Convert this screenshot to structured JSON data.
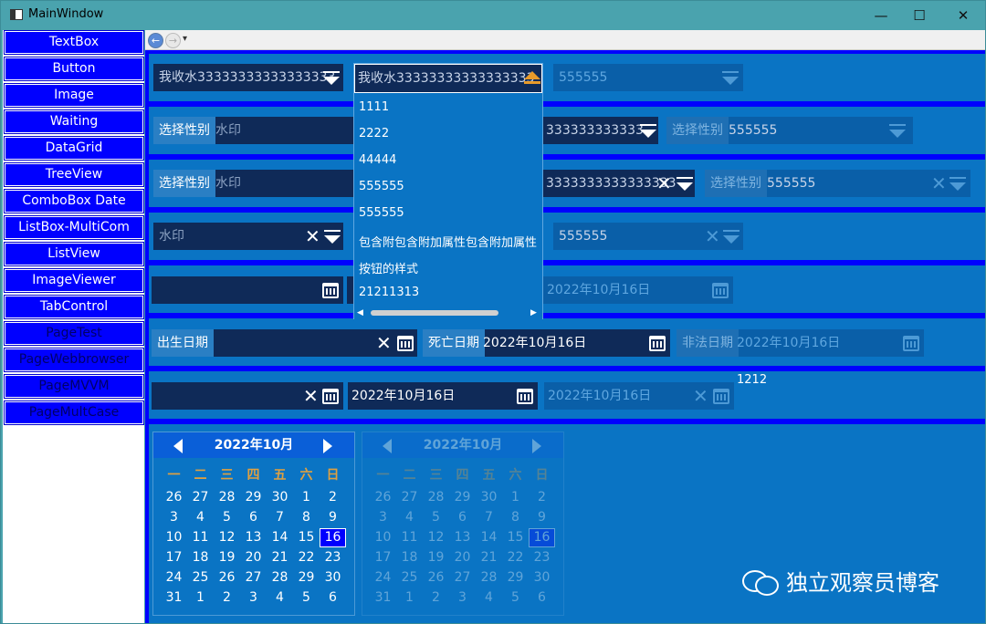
{
  "window": {
    "title": "MainWindow",
    "min": "—",
    "max": "☐",
    "close": "✕"
  },
  "sidebar": {
    "items": [
      {
        "label": "TextBox"
      },
      {
        "label": "Button"
      },
      {
        "label": "Image"
      },
      {
        "label": "Waiting"
      },
      {
        "label": "DataGrid"
      },
      {
        "label": "TreeView"
      },
      {
        "label": "ComboBox Date"
      },
      {
        "label": "ListBox-MultiCom"
      },
      {
        "label": "ListView"
      },
      {
        "label": "ImageViewer"
      },
      {
        "label": "TabControl"
      },
      {
        "label": "PageTest"
      },
      {
        "label": "PageWebbrowser"
      },
      {
        "label": "PageMVVM"
      },
      {
        "label": "PageMultCase"
      }
    ]
  },
  "browser": {
    "back": "←",
    "fwd": "→",
    "menu": "▾"
  },
  "row1": {
    "c1": "我收水33333333333333333",
    "c2": "我收水33333333333333333",
    "c3": "555555"
  },
  "row2": {
    "label": "选择性别",
    "c1": "水印",
    "c2": "333333333333",
    "label2": "选择性别",
    "c3": "555555"
  },
  "row3": {
    "label": "选择性别",
    "c1": "水印",
    "c2": "3333333333333333",
    "label2": "选择性别",
    "c3": "555555"
  },
  "row4": {
    "c1": "水印",
    "c3": "555555"
  },
  "row5": {
    "c3": "2022年10月16日"
  },
  "row6": {
    "l1": "出生日期",
    "l2": "死亡日期",
    "v2": "2022年10月16日",
    "l3": "非法日期",
    "v3": "2022年10月16日"
  },
  "row7": {
    "v2": "2022年10月16日",
    "v3": "2022年10月16日",
    "note": "1212"
  },
  "dropdown": {
    "items": [
      "1111",
      "2222",
      "44444",
      "555555",
      "555555",
      "包含附包含附加属性包含附加属性",
      "按钮的样式",
      "21211313"
    ]
  },
  "calendar": {
    "title": "2022年10月",
    "weekdays": [
      "一",
      "二",
      "三",
      "四",
      "五",
      "六",
      "日"
    ],
    "days": [
      "26",
      "27",
      "28",
      "29",
      "30",
      "1",
      "2",
      "3",
      "4",
      "5",
      "6",
      "7",
      "8",
      "9",
      "10",
      "11",
      "12",
      "13",
      "14",
      "15",
      "16",
      "17",
      "18",
      "19",
      "20",
      "21",
      "22",
      "23",
      "24",
      "25",
      "26",
      "27",
      "28",
      "29",
      "30",
      "31",
      "1",
      "2",
      "3",
      "4",
      "5",
      "6"
    ]
  },
  "watermark": {
    "text": "独立观察员博客"
  },
  "colors": {
    "sidebar_button": "#0000ff",
    "panel": "#0a74c4",
    "field": "#0f2a58",
    "accent": "#e0a040"
  }
}
